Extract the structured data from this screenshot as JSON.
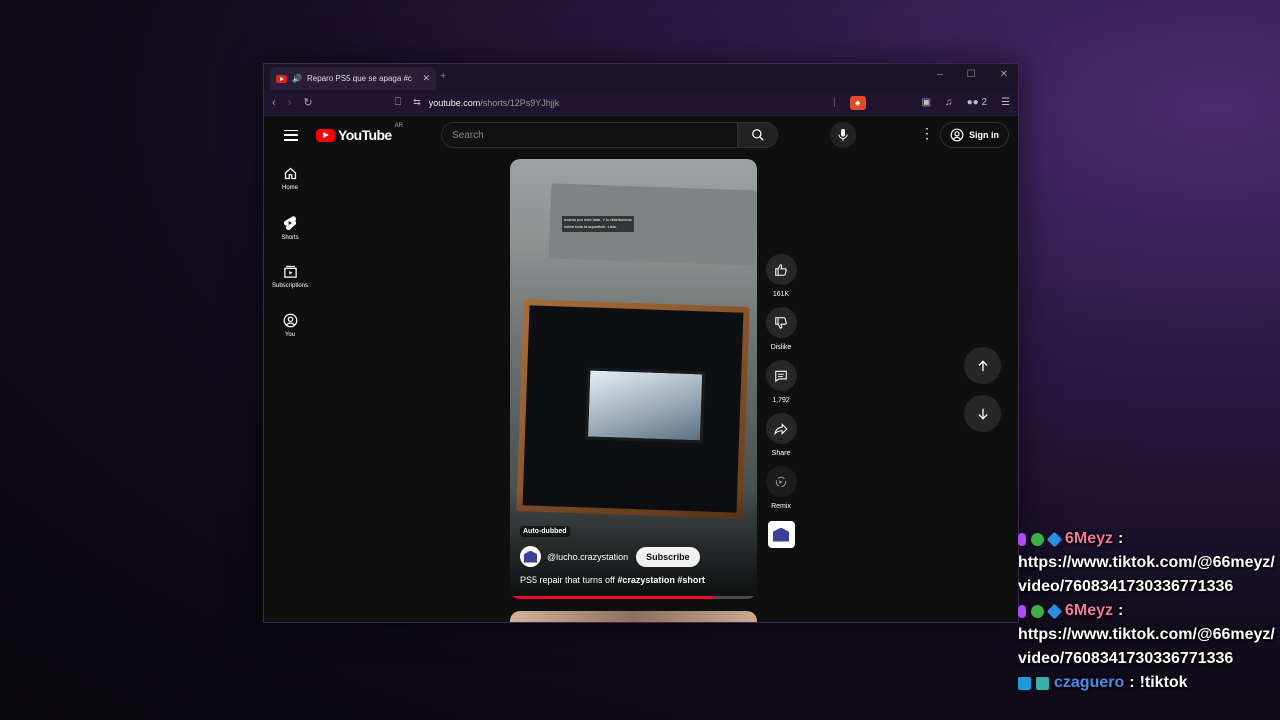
{
  "browser": {
    "tab_title": "Reparo PS5 que se apaga #c",
    "tab_close": "✕",
    "new_tab": "+",
    "url_host": "youtube.com",
    "url_path": "/shorts/12Ps9YJhjjk",
    "extension_count": "2"
  },
  "youtube": {
    "logo_text": "YouTube",
    "country": "AR",
    "search_placeholder": "Search",
    "signin_label": "Sign in",
    "guide": [
      {
        "label": "Home",
        "icon": "home-icon"
      },
      {
        "label": "Shorts",
        "icon": "shorts-icon"
      },
      {
        "label": "Subscriptions",
        "icon": "subscriptions-icon"
      },
      {
        "label": "You",
        "icon": "account-icon"
      }
    ],
    "short": {
      "caption_overlay": "ncamo por este lado. Y lo distribuimos sobre toda la superficie. Listo.",
      "auto_dubbed": "Auto-dubbed",
      "channel": "@lucho.crazystation",
      "subscribe": "Subscribe",
      "title_plain": "PS5 repair that turns off ",
      "title_tags": "#crazystation #short",
      "progress": 0.82
    },
    "actions": {
      "likes": "161K",
      "dislike": "Dislike",
      "comments": "1,792",
      "share": "Share",
      "remix": "Remix"
    }
  },
  "chat": [
    {
      "user": "6Meyz",
      "text": "https://www.tiktok.com/@66meyz/video/7608341730336771336",
      "color": "#f07a9e"
    },
    {
      "user": "6Meyz",
      "text": "https://www.tiktok.com/@66meyz/video/7608341730336771336",
      "color": "#f07a9e"
    },
    {
      "user": "czaguero",
      "text": "!tiktok",
      "color": "#4a8ce8"
    }
  ]
}
